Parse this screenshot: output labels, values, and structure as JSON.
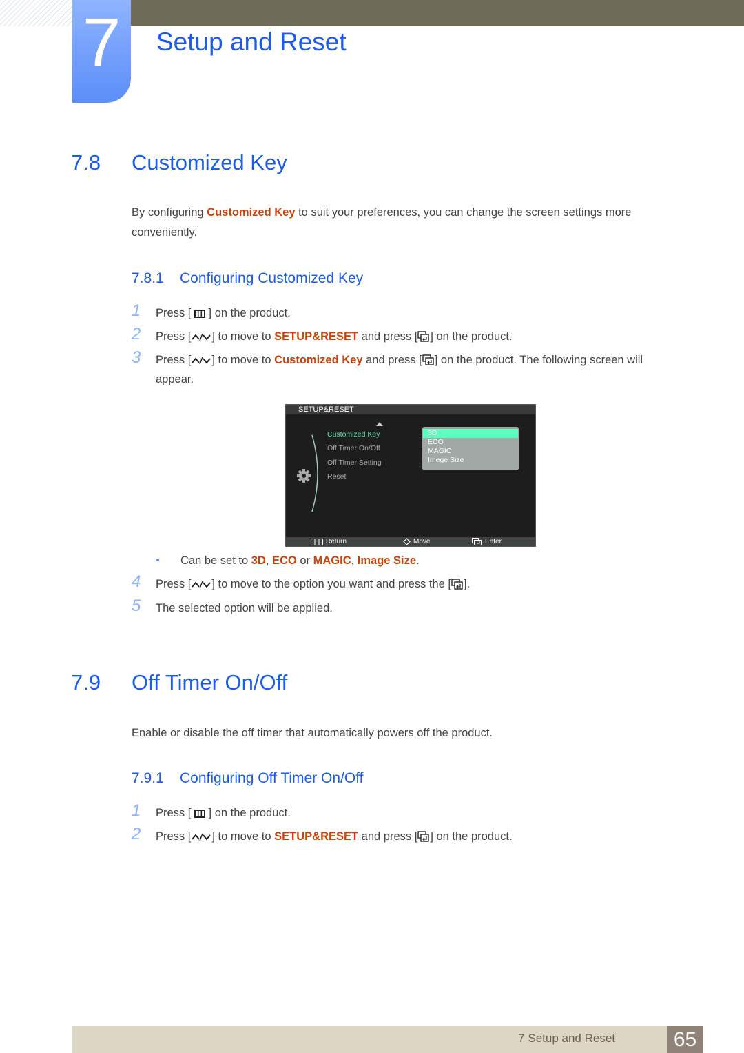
{
  "chapter": {
    "number": "7",
    "title": "Setup and Reset"
  },
  "sections": {
    "s78": {
      "number": "7.8",
      "title": "Customized Key",
      "intro_pre": "By configuring ",
      "intro_hl": "Customized Key",
      "intro_post": " to suit your preferences, you can change the screen settings more",
      "intro_line2": "conveniently.",
      "sub": {
        "number": "7.8.1",
        "title": "Configuring Customized Key"
      },
      "steps": [
        {
          "n": "1",
          "pre": "Press [",
          "post": "] on the product."
        },
        {
          "n": "2",
          "pre": "Press [",
          "mid": "] to move to ",
          "hl": "SETUP&RESET",
          "mid2": " and press [",
          "post": "] on the product."
        },
        {
          "n": "3",
          "pre": "Press [",
          "mid": "] to move to ",
          "hl": "Customized Key",
          "mid2": " and press [",
          "post": "] on the product. The following screen will",
          "line2": "appear."
        },
        {
          "n": "4",
          "pre": "Press [",
          "mid": "] to move to the option you want and press the [",
          "post": "]."
        },
        {
          "n": "5",
          "text": "The selected option will be applied."
        }
      ],
      "bullet": {
        "pre": "Can be set to ",
        "opt1": "3D",
        "sep1": ", ",
        "opt2": "ECO",
        "sep2": " or ",
        "opt3": "MAGIC",
        "sep3": ", ",
        "opt4": "Image Size",
        "end": "."
      }
    },
    "s79": {
      "number": "7.9",
      "title": "Off Timer On/Off",
      "intro": "Enable or disable the off timer that automatically powers off the product.",
      "sub": {
        "number": "7.9.1",
        "title": "Configuring Off Timer On/Off"
      },
      "steps": [
        {
          "n": "1",
          "pre": "Press [",
          "post": "] on the product."
        },
        {
          "n": "2",
          "pre": "Press [",
          "mid": "] to move to ",
          "hl": "SETUP&RESET",
          "mid2": " and press [",
          "post": "] on the product."
        }
      ]
    }
  },
  "osd": {
    "header": "SETUP&RESET",
    "menu_items": [
      {
        "label": "Customized Key",
        "active": true
      },
      {
        "label": "Off Timer On/Off",
        "active": false
      },
      {
        "label": "Off Timer Setting",
        "active": false
      },
      {
        "label": "Reset",
        "active": false
      }
    ],
    "colon": ":",
    "dropdown_options": [
      "3D",
      "ECO",
      "MAGIC",
      "Imege Size"
    ],
    "selected_option": "3D",
    "footer": {
      "return": "Return",
      "move": "Move",
      "enter": "Enter"
    }
  },
  "footer": {
    "label": "7 Setup and Reset",
    "page": "65"
  },
  "colors": {
    "heading_blue": "#1a5cf0",
    "highlight_orange": "#c8440a",
    "osd_active_green": "#5fe3aa",
    "osd_selected": "#5ffdbd"
  }
}
